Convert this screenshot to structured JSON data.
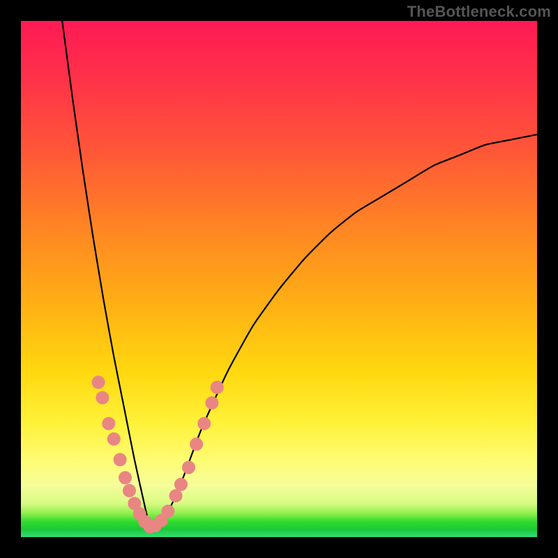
{
  "watermark": "TheBottleneck.com",
  "chart_data": {
    "type": "line",
    "title": "",
    "xlabel": "",
    "ylabel": "",
    "xlim": [
      0,
      100
    ],
    "ylim": [
      0,
      100
    ],
    "grid": false,
    "legend": false,
    "note": "V-shaped bottleneck curve over a red→yellow→green gradient. Minimum reaches y≈0 near x≈25. Curve exits top-left near x≈8 and rises to y≈78 at x=100. Salmon dots cluster along the curve's lower arms.",
    "series": [
      {
        "name": "bottleneck-curve",
        "x": [
          8,
          10,
          12,
          14,
          16,
          18,
          20,
          22,
          24,
          25,
          26,
          28,
          30,
          32,
          35,
          40,
          45,
          50,
          55,
          60,
          65,
          70,
          75,
          80,
          85,
          90,
          95,
          100
        ],
        "y": [
          100,
          85,
          71,
          58,
          46,
          35,
          25,
          15,
          6,
          2,
          2,
          4,
          8,
          13,
          21,
          32,
          41,
          48,
          54,
          59,
          63,
          66,
          69,
          72,
          74,
          76,
          77,
          78
        ]
      }
    ],
    "dots": [
      {
        "x": 15.0,
        "y": 30
      },
      {
        "x": 15.8,
        "y": 27
      },
      {
        "x": 17.0,
        "y": 22
      },
      {
        "x": 18.0,
        "y": 19
      },
      {
        "x": 19.2,
        "y": 15
      },
      {
        "x": 20.2,
        "y": 11.5
      },
      {
        "x": 21.0,
        "y": 9
      },
      {
        "x": 22.0,
        "y": 6.5
      },
      {
        "x": 23.0,
        "y": 4.5
      },
      {
        "x": 24.0,
        "y": 3
      },
      {
        "x": 25.0,
        "y": 2
      },
      {
        "x": 26.0,
        "y": 2.2
      },
      {
        "x": 27.2,
        "y": 3.2
      },
      {
        "x": 28.5,
        "y": 5
      },
      {
        "x": 30.0,
        "y": 8
      },
      {
        "x": 31.0,
        "y": 10.2
      },
      {
        "x": 32.5,
        "y": 13.5
      },
      {
        "x": 34.0,
        "y": 18
      },
      {
        "x": 35.5,
        "y": 22
      },
      {
        "x": 37.0,
        "y": 26
      },
      {
        "x": 38.0,
        "y": 29
      }
    ],
    "colors": {
      "curve": "#000000",
      "dots": "#e98683",
      "gradient_top": "#ff1a55",
      "gradient_mid": "#ffd80f",
      "gradient_bottom": "#2fdb2f"
    }
  }
}
